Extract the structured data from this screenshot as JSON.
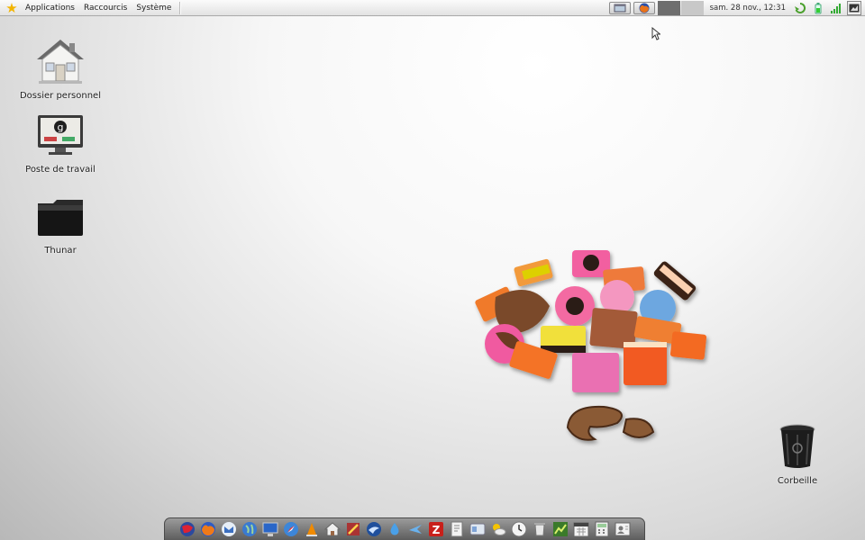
{
  "top_panel": {
    "menus": [
      "Applications",
      "Raccourcis",
      "Système"
    ],
    "clock": "sam. 28 nov., 12:31"
  },
  "desktop": {
    "icons": [
      {
        "label": "Dossier personnel",
        "icon": "home-icon"
      },
      {
        "label": "Poste de travail",
        "icon": "computer-icon"
      },
      {
        "label": "Thunar",
        "icon": "folder-icon"
      },
      {
        "label": "Corbeille",
        "icon": "trash-icon"
      }
    ]
  },
  "dock": {
    "items": [
      "web-browser-icon",
      "firefox-icon",
      "mail-icon",
      "globe-icon",
      "monitor-icon",
      "safari-icon",
      "vlc-icon",
      "home-icon",
      "text-editor-icon",
      "thunderbird-icon",
      "drop-icon",
      "plane-icon",
      "filezilla-icon",
      "document-icon",
      "finder-icon",
      "weather-icon",
      "clock-icon",
      "trash-bin-icon",
      "chart-icon",
      "calendar-icon",
      "calculator-icon",
      "contacts-icon"
    ]
  },
  "colors": {
    "panel": "#ececec",
    "dock": "#7a7a7a",
    "accent_star": "#f2b400"
  }
}
